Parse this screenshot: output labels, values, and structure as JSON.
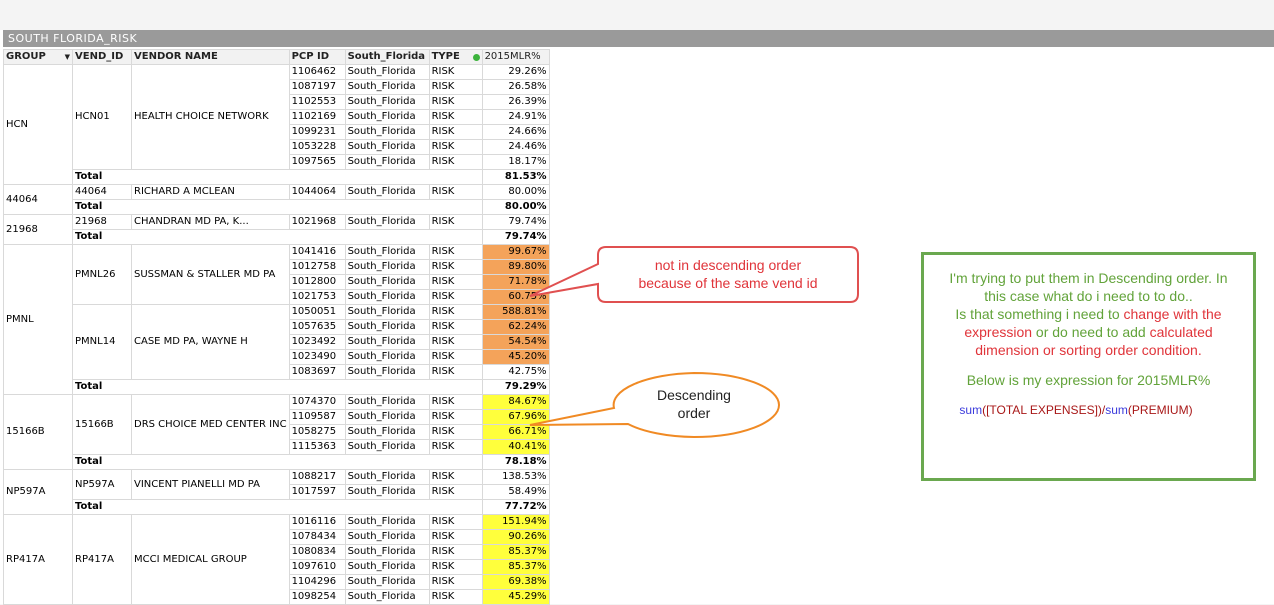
{
  "window": {
    "title": "SOUTH FLORIDA_RISK"
  },
  "columns": [
    "GROUP",
    "VEND_ID",
    "VENDOR NAME",
    "PCP ID",
    "South_Florida",
    "TYPE",
    "2015MLR%"
  ],
  "total_label": "Total",
  "groups": [
    {
      "group": "HCN",
      "vend_id": "HCN01",
      "vendor_name": "HEALTH CHOICE NETWORK",
      "rows": [
        {
          "pcp": "1106462",
          "region": "South_Florida",
          "type": "RISK",
          "mlr": "29.26%"
        },
        {
          "pcp": "1087197",
          "region": "South_Florida",
          "type": "RISK",
          "mlr": "26.58%"
        },
        {
          "pcp": "1102553",
          "region": "South_Florida",
          "type": "RISK",
          "mlr": "26.39%"
        },
        {
          "pcp": "1102169",
          "region": "South_Florida",
          "type": "RISK",
          "mlr": "24.91%"
        },
        {
          "pcp": "1099231",
          "region": "South_Florida",
          "type": "RISK",
          "mlr": "24.66%"
        },
        {
          "pcp": "1053228",
          "region": "South_Florida",
          "type": "RISK",
          "mlr": "24.46%"
        },
        {
          "pcp": "1097565",
          "region": "South_Florida",
          "type": "RISK",
          "mlr": "18.17%"
        }
      ],
      "total": "81.53%"
    },
    {
      "group": "44064",
      "vend_id": "44064",
      "vendor_name": "RICHARD A MCLEAN",
      "rows": [
        {
          "pcp": "1044064",
          "region": "South_Florida",
          "type": "RISK",
          "mlr": "80.00%"
        }
      ],
      "total": "80.00%"
    },
    {
      "group": "21968",
      "vend_id": "21968",
      "vendor_name": "CHANDRAN MD PA, K...",
      "rows": [
        {
          "pcp": "1021968",
          "region": "South_Florida",
          "type": "RISK",
          "mlr": "79.74%"
        }
      ],
      "total": "79.74%"
    },
    {
      "group": "PMNL",
      "vendors": [
        {
          "vend_id": "PMNL26",
          "vendor_name": "SUSSMAN & STALLER MD PA",
          "rows": [
            {
              "pcp": "1041416",
              "region": "South_Florida",
              "type": "RISK",
              "mlr": "99.67%"
            },
            {
              "pcp": "1012758",
              "region": "South_Florida",
              "type": "RISK",
              "mlr": "89.80%"
            },
            {
              "pcp": "1012800",
              "region": "South_Florida",
              "type": "RISK",
              "mlr": "71.78%"
            },
            {
              "pcp": "1021753",
              "region": "South_Florida",
              "type": "RISK",
              "mlr": "60.75%"
            }
          ]
        },
        {
          "vend_id": "PMNL14",
          "vendor_name": "CASE MD PA, WAYNE H",
          "rows": [
            {
              "pcp": "1050051",
              "region": "South_Florida",
              "type": "RISK",
              "mlr": "588.81%"
            },
            {
              "pcp": "1057635",
              "region": "South_Florida",
              "type": "RISK",
              "mlr": "62.24%"
            },
            {
              "pcp": "1023492",
              "region": "South_Florida",
              "type": "RISK",
              "mlr": "54.54%"
            },
            {
              "pcp": "1023490",
              "region": "South_Florida",
              "type": "RISK",
              "mlr": "45.20%"
            },
            {
              "pcp": "1083697",
              "region": "South_Florida",
              "type": "RISK",
              "mlr": "42.75%"
            }
          ]
        }
      ],
      "total": "79.29%"
    },
    {
      "group": "15166B",
      "vend_id": "15166B",
      "vendor_name": "DRS CHOICE MED CENTER INC",
      "rows": [
        {
          "pcp": "1074370",
          "region": "South_Florida",
          "type": "RISK",
          "mlr": "84.67%"
        },
        {
          "pcp": "1109587",
          "region": "South_Florida",
          "type": "RISK",
          "mlr": "67.96%"
        },
        {
          "pcp": "1058275",
          "region": "South_Florida",
          "type": "RISK",
          "mlr": "66.71%"
        },
        {
          "pcp": "1115363",
          "region": "South_Florida",
          "type": "RISK",
          "mlr": "40.41%"
        }
      ],
      "total": "78.18%"
    },
    {
      "group": "NP597A",
      "vend_id": "NP597A",
      "vendor_name": "VINCENT PIANELLI MD PA",
      "rows": [
        {
          "pcp": "1088217",
          "region": "South_Florida",
          "type": "RISK",
          "mlr": "138.53%"
        },
        {
          "pcp": "1017597",
          "region": "South_Florida",
          "type": "RISK",
          "mlr": "58.49%"
        }
      ],
      "total": "77.72%"
    },
    {
      "group": "RP417A",
      "vend_id": "RP417A",
      "vendor_name": "MCCI MEDICAL GROUP",
      "rows": [
        {
          "pcp": "1016116",
          "region": "South_Florida",
          "type": "RISK",
          "mlr": "151.94%"
        },
        {
          "pcp": "1078434",
          "region": "South_Florida",
          "type": "RISK",
          "mlr": "90.26%"
        },
        {
          "pcp": "1080834",
          "region": "South_Florida",
          "type": "RISK",
          "mlr": "85.37%"
        },
        {
          "pcp": "1097610",
          "region": "South_Florida",
          "type": "RISK",
          "mlr": "85.37%"
        },
        {
          "pcp": "1104296",
          "region": "South_Florida",
          "type": "RISK",
          "mlr": "69.38%"
        },
        {
          "pcp": "1098254",
          "region": "South_Florida",
          "type": "RISK",
          "mlr": "45.29%"
        }
      ]
    }
  ],
  "highlight_colors": {
    "orange": "#f4a35a",
    "yellow": "#ffff3c"
  },
  "callouts": {
    "not_descending_line1": "not in descending order",
    "not_descending_line2": "because of the same vend id",
    "descending_line1": "Descending",
    "descending_line2": "order"
  },
  "note": {
    "line1": "I'm trying to put them in Descending order. In",
    "line2": "this case what do i need to to do..",
    "line3_a": "Is that something i need to ",
    "line3_b": "change with the",
    "line4_a": "expression",
    "line4_b": " or do need to add ",
    "line4_c": "calculated",
    "line5": "dimension or sorting order condition.",
    "line6": "Below is my expression for 2015MLR%",
    "expr_fn1": "sum",
    "expr_arg1": "([TOTAL EXPENSES])/",
    "expr_fn2": "sum",
    "expr_arg2": "(PREMIUM)"
  }
}
